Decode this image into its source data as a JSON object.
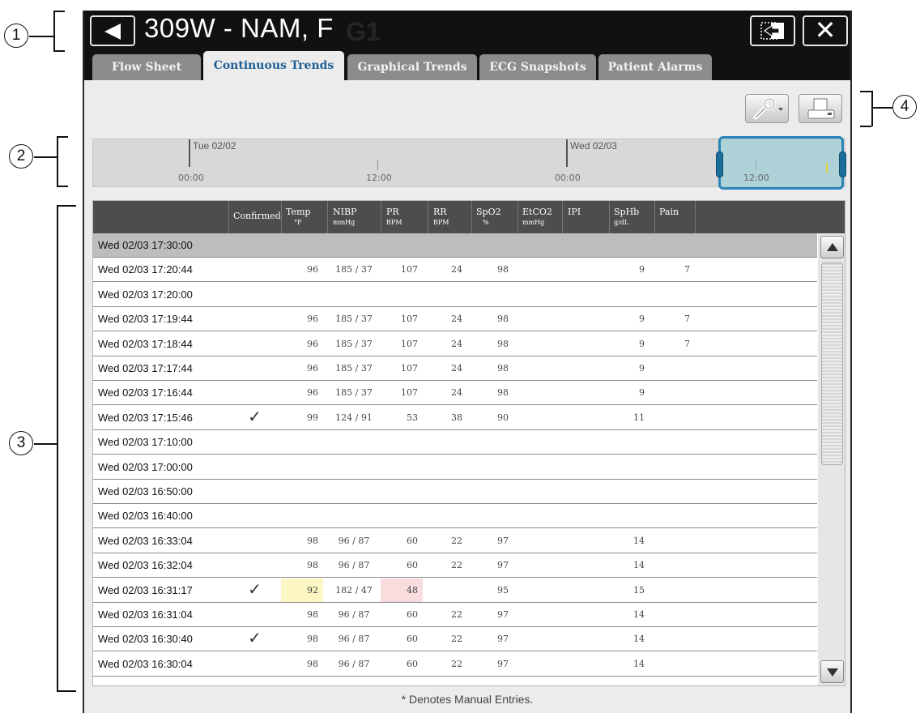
{
  "header": {
    "patient_title": "309W - NAM, F",
    "bed_ghost": "G1"
  },
  "tabs": [
    {
      "label": "Flow Sheet",
      "active": false
    },
    {
      "label": "Continuous Trends",
      "active": true
    },
    {
      "label": "Graphical Trends",
      "active": false
    },
    {
      "label": "ECG Snapshots",
      "active": false
    },
    {
      "label": "Patient Alarms",
      "active": false
    }
  ],
  "callouts": [
    "1",
    "2",
    "3",
    "4"
  ],
  "timeline": {
    "day_labels": [
      "Tue 02/02",
      "Wed 02/03"
    ],
    "hour_labels": [
      "00:00",
      "12:00",
      "00:00",
      "12:00"
    ]
  },
  "table": {
    "columns": [
      {
        "title": "Confirmed",
        "unit": ""
      },
      {
        "title": "Temp",
        "unit": "°F"
      },
      {
        "title": "NIBP",
        "unit": "mmHg"
      },
      {
        "title": "PR",
        "unit": "BPM"
      },
      {
        "title": "RR",
        "unit": "BPM"
      },
      {
        "title": "SpO2",
        "unit": "%"
      },
      {
        "title": "EtCO2",
        "unit": "mmHg"
      },
      {
        "title": "IPI",
        "unit": ""
      },
      {
        "title": "SpHb",
        "unit": "g/dL"
      },
      {
        "title": "Pain",
        "unit": ""
      }
    ],
    "rows": [
      {
        "datetime": "Wed 02/03  17:30:00",
        "confirmed": "",
        "temp": "",
        "nibp": "",
        "pr": "",
        "rr": "",
        "spo2": "",
        "sphb": "",
        "pain": "",
        "selected": true
      },
      {
        "datetime": "Wed 02/03  17:20:44",
        "confirmed": "",
        "temp": "96",
        "nibp": "185 / 37",
        "pr": "107",
        "rr": "24",
        "spo2": "98",
        "sphb": "9",
        "pain": "7"
      },
      {
        "datetime": "Wed 02/03  17:20:00",
        "confirmed": "",
        "temp": "",
        "nibp": "",
        "pr": "",
        "rr": "",
        "spo2": "",
        "sphb": "",
        "pain": ""
      },
      {
        "datetime": "Wed 02/03  17:19:44",
        "confirmed": "",
        "temp": "96",
        "nibp": "185 / 37",
        "pr": "107",
        "rr": "24",
        "spo2": "98",
        "sphb": "9",
        "pain": "7"
      },
      {
        "datetime": "Wed 02/03  17:18:44",
        "confirmed": "",
        "temp": "96",
        "nibp": "185 / 37",
        "pr": "107",
        "rr": "24",
        "spo2": "98",
        "sphb": "9",
        "pain": "7"
      },
      {
        "datetime": "Wed 02/03  17:17:44",
        "confirmed": "",
        "temp": "96",
        "nibp": "185 / 37",
        "pr": "107",
        "rr": "24",
        "spo2": "98",
        "sphb": "9",
        "pain": ""
      },
      {
        "datetime": "Wed 02/03  17:16:44",
        "confirmed": "",
        "temp": "96",
        "nibp": "185 / 37",
        "pr": "107",
        "rr": "24",
        "spo2": "98",
        "sphb": "9",
        "pain": ""
      },
      {
        "datetime": "Wed 02/03  17:15:46",
        "confirmed": "✓",
        "temp": "99",
        "nibp": "124 / 91",
        "pr": "53",
        "rr": "38",
        "spo2": "90",
        "sphb": "11",
        "pain": ""
      },
      {
        "datetime": "Wed 02/03  17:10:00",
        "confirmed": "",
        "temp": "",
        "nibp": "",
        "pr": "",
        "rr": "",
        "spo2": "",
        "sphb": "",
        "pain": ""
      },
      {
        "datetime": "Wed 02/03  17:00:00",
        "confirmed": "",
        "temp": "",
        "nibp": "",
        "pr": "",
        "rr": "",
        "spo2": "",
        "sphb": "",
        "pain": ""
      },
      {
        "datetime": "Wed 02/03  16:50:00",
        "confirmed": "",
        "temp": "",
        "nibp": "",
        "pr": "",
        "rr": "",
        "spo2": "",
        "sphb": "",
        "pain": ""
      },
      {
        "datetime": "Wed 02/03  16:40:00",
        "confirmed": "",
        "temp": "",
        "nibp": "",
        "pr": "",
        "rr": "",
        "spo2": "",
        "sphb": "",
        "pain": ""
      },
      {
        "datetime": "Wed 02/03  16:33:04",
        "confirmed": "",
        "temp": "98",
        "nibp": "96 / 87",
        "pr": "60",
        "rr": "22",
        "spo2": "97",
        "sphb": "14",
        "pain": ""
      },
      {
        "datetime": "Wed 02/03  16:32:04",
        "confirmed": "",
        "temp": "98",
        "nibp": "96 / 87",
        "pr": "60",
        "rr": "22",
        "spo2": "97",
        "sphb": "14",
        "pain": ""
      },
      {
        "datetime": "Wed 02/03  16:31:17",
        "confirmed": "✓",
        "temp": "92",
        "nibp": "182 / 47",
        "pr": "48",
        "rr": "",
        "spo2": "95",
        "sphb": "15",
        "pain": "",
        "temp_flag": "#fbf6c2",
        "pr_flag": "#f9dcdd"
      },
      {
        "datetime": "Wed 02/03  16:31:04",
        "confirmed": "",
        "temp": "98",
        "nibp": "96 / 87",
        "pr": "60",
        "rr": "22",
        "spo2": "97",
        "sphb": "14",
        "pain": ""
      },
      {
        "datetime": "Wed 02/03  16:30:40",
        "confirmed": "✓",
        "temp": "98",
        "nibp": "96 / 87",
        "pr": "60",
        "rr": "22",
        "spo2": "97",
        "sphb": "14",
        "pain": ""
      },
      {
        "datetime": "Wed 02/03  16:30:04",
        "confirmed": "",
        "temp": "98",
        "nibp": "96 / 87",
        "pr": "60",
        "rr": "22",
        "spo2": "97",
        "sphb": "14",
        "pain": ""
      }
    ]
  },
  "footer": {
    "note": "* Denotes Manual Entries."
  },
  "icons": {
    "back": "back-arrow-icon",
    "export": "export-icon",
    "close": "close-icon",
    "settings": "wrench-icon",
    "print": "printer-icon",
    "scroll_up": "scroll-up-icon",
    "scroll_down": "scroll-down-icon"
  },
  "colors": {
    "active_tab_text": "#1f5f93",
    "selection_border": "#2b84b8",
    "temp_alert": "#fbf6c2",
    "pr_alert": "#f9dcdd"
  }
}
